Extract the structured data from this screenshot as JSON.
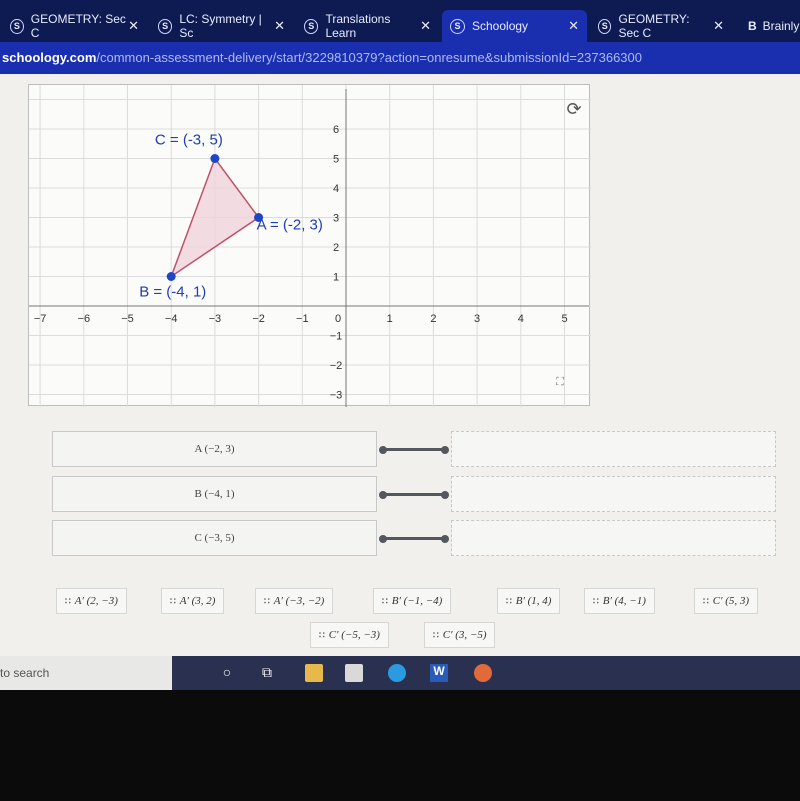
{
  "browser": {
    "tabs": [
      {
        "label": "GEOMETRY: Sec C",
        "active": false
      },
      {
        "label": "LC: Symmetry | Sc",
        "active": false
      },
      {
        "label": "Translations Learn",
        "active": false
      },
      {
        "label": "Schoology",
        "active": true
      },
      {
        "label": "GEOMETRY: Sec C",
        "active": false
      },
      {
        "label": "Brainly",
        "active": false
      }
    ],
    "url_domain": "schoology.com",
    "url_path": "/common-assessment-delivery/start/3229810379?action=onresume&submissionId=237366300"
  },
  "graph": {
    "x_ticks": [
      -7,
      -6,
      -5,
      -4,
      -3,
      -2,
      -1,
      0,
      1,
      2,
      3,
      4,
      5
    ],
    "y_ticks": [
      -3,
      -2,
      -1,
      1,
      2,
      3,
      4,
      5,
      6
    ],
    "points": [
      {
        "name": "A",
        "x": -2,
        "y": 3,
        "label": "A = (-2, 3)"
      },
      {
        "name": "B",
        "x": -4,
        "y": 1,
        "label": "B = (-4, 1)"
      },
      {
        "name": "C",
        "x": -3,
        "y": 5,
        "label": "C = (-3, 5)"
      }
    ],
    "point_color": "#1f45c8",
    "fill_color": "#f1d3dc",
    "edge_color": "#c0506a",
    "reset_icon": "refresh-icon",
    "fullscreen_icon": "expand-icon"
  },
  "matching": {
    "rows": [
      {
        "label": "A (−2, 3)"
      },
      {
        "label": "B (−4, 1)"
      },
      {
        "label": "C (−3, 5)"
      }
    ]
  },
  "choices": [
    "A′ (2, −3)",
    "A′ (3, 2)",
    "A′ (−3, −2)",
    "B′ (−1, −4)",
    "B′ (1, 4)",
    "B′ (4, −1)",
    "C′ (5, 3)",
    "C′ (−5, −3)",
    "C′ (3, −5)"
  ],
  "drag_handle": "∷",
  "taskbar": {
    "search_text": "to search"
  }
}
